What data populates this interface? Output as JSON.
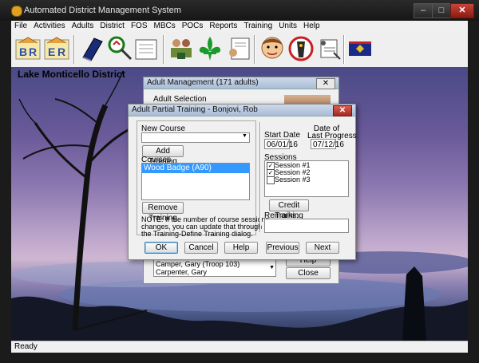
{
  "window": {
    "title": "Automated District Management System",
    "btn_min": "–",
    "btn_max": "□",
    "btn_close": "✕"
  },
  "menu": [
    "File",
    "Activities",
    "Adults",
    "District",
    "FOS",
    "MBCs",
    "POCs",
    "Reports",
    "Training",
    "Units",
    "Help"
  ],
  "toolbar": {
    "icons": [
      "badge-br-icon",
      "badge-er-icon",
      "book-icon",
      "magnifier-icon",
      "clipboard-icon",
      "meeting-icon",
      "fleur-de-lis-icon",
      "document-icon",
      "person-face-icon",
      "bowling-icon",
      "notes-icon",
      "flag-icon"
    ],
    "colors": {
      "badge": "#2a4fb0",
      "book": "#1a2a7a",
      "fleur": "#1a9a2a",
      "flag": "#1a2a8a",
      "flag_accent": "#e8c020",
      "red": "#c82020"
    }
  },
  "district_name": "Lake Monticello District",
  "adult_management": {
    "title": "Adult Management",
    "count": "(171 adults)",
    "section_label": "Adult Selection",
    "list": [
      "Camper,   Gary  (Troop 103)",
      "Carpenter,   Gary"
    ],
    "btn_help": "Help",
    "btn_close": "Close",
    "close_glyph": "✕"
  },
  "dialog": {
    "title": "Adult Partial Training - Bonjovi,   Rob",
    "close_glyph": "✕",
    "new_course_label": "New Course",
    "new_course_value": "",
    "add_training": "Add Training",
    "courses_label": "Courses",
    "courses": [
      "Wood Badge  (A90)"
    ],
    "remove_training": "Remove Training",
    "note": [
      "NOTE: If the number of course sessions",
      "changes, you can update that through",
      "the Training-Define Training dialog."
    ],
    "start_date_label": "Start Date",
    "start_date": "06/01/16",
    "last_progress_label": [
      "Date of",
      "Last Progress"
    ],
    "last_progress": "07/12/16",
    "sessions_label": "Sessions",
    "sessions": [
      {
        "label": "Session #1",
        "checked": true
      },
      {
        "label": "Session #2",
        "checked": true
      },
      {
        "label": "Session #3",
        "checked": false
      }
    ],
    "credit_training": "Credit Training",
    "remarks_label": "Remarks:",
    "buttons": {
      "ok": "OK",
      "cancel": "Cancel",
      "help": "Help",
      "previous": "Previous",
      "next": "Next"
    }
  },
  "status": "Ready"
}
